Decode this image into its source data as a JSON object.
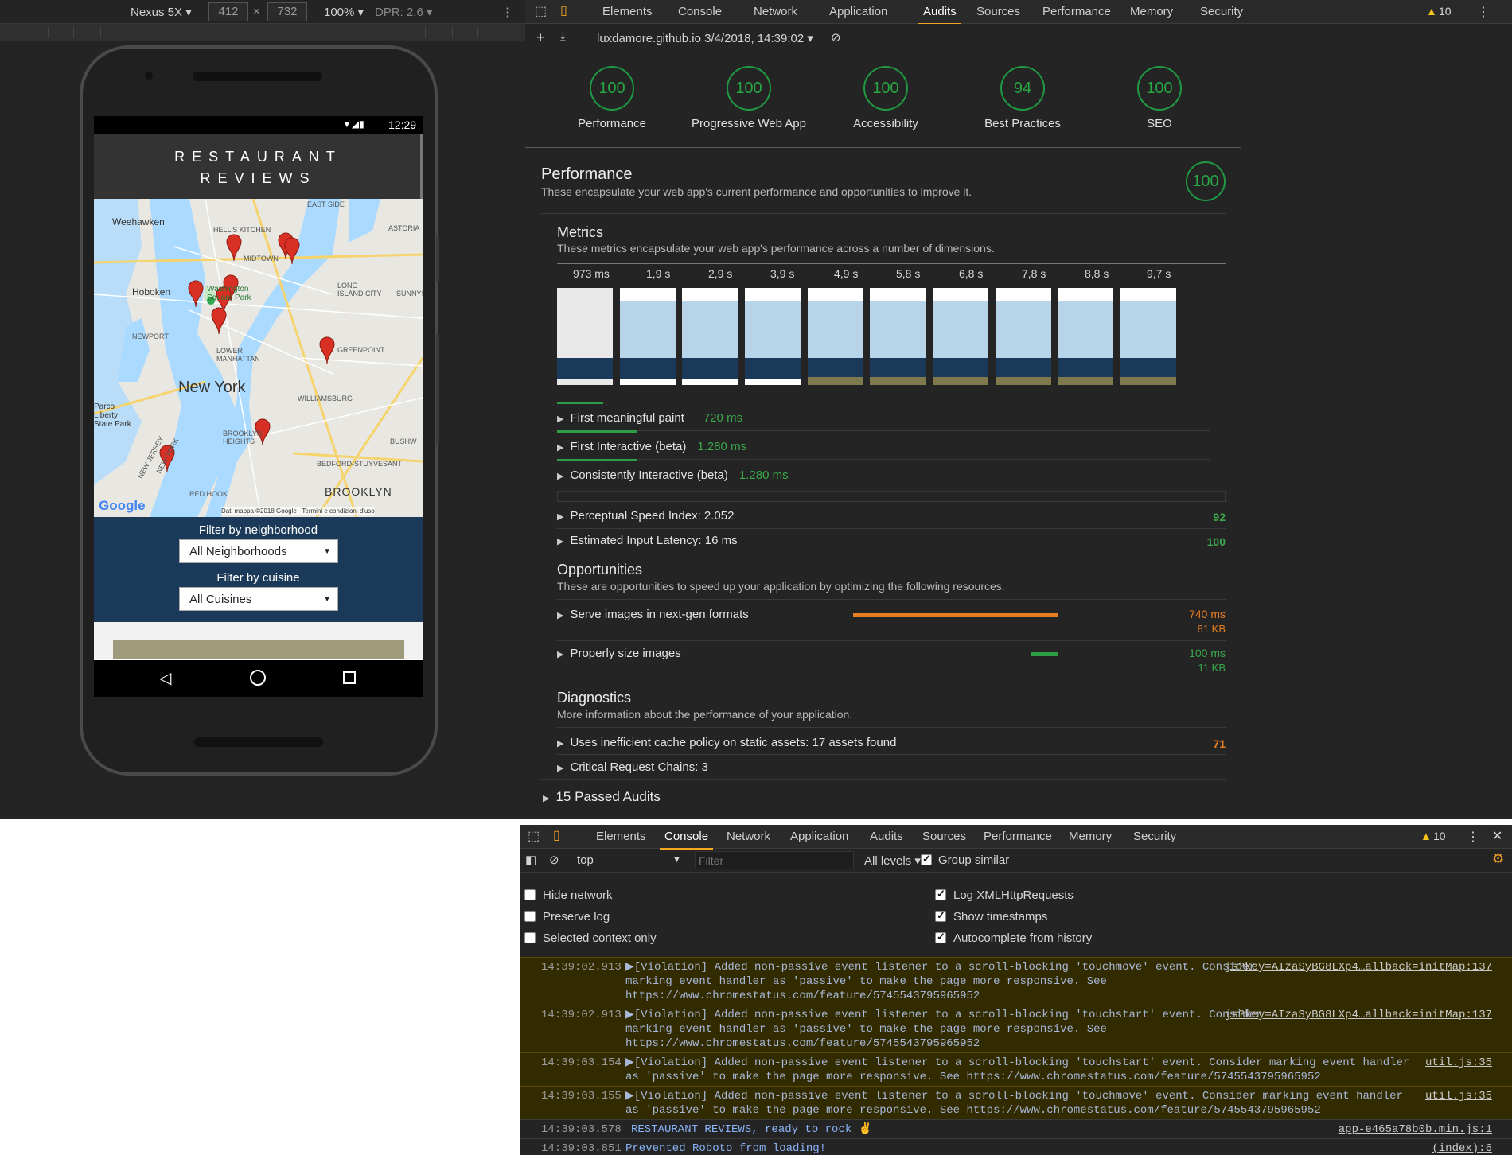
{
  "device_toolbar": {
    "device": "Nexus 5X",
    "width": "412",
    "height": "732",
    "zoom": "100%",
    "dpr": "DPR: 2.6"
  },
  "phone": {
    "status_time": "12:29",
    "app_title_line1": "RESTAURANT",
    "app_title_line2": "REVIEWS",
    "map_city": "New York",
    "map_labels": [
      "Weehawken",
      "HELL'S KITCHEN",
      "MIDTOWN",
      "EAST SIDE",
      "ASTORIA",
      "Hoboken",
      "LONG ISLAND CITY",
      "SUNNYS",
      "NEWPORT",
      "Washington Square Park",
      "LOWER MANHATTAN",
      "GREENPOINT",
      "WILLIAMSBURG",
      "Parco Liberty State Park",
      "BROOKLYN HEIGHTS",
      "BUSHW",
      "NEW JERSEY",
      "NEW YORK",
      "BEDFORD-STUYVESANT",
      "RED HOOK",
      "BROOKLYN"
    ],
    "map_attribution": "Dati mappa ©2018 Google   Termini e condizioni d'uso",
    "google_logo": "Google",
    "filter_neighborhood_label": "Filter by neighborhood",
    "filter_neighborhood_value": "All Neighborhoods",
    "filter_cuisine_label": "Filter by cuisine",
    "filter_cuisine_value": "All Cuisines"
  },
  "top_devtools": {
    "tabs": [
      "Elements",
      "Console",
      "Network",
      "Application",
      "Audits",
      "Sources",
      "Performance",
      "Memory",
      "Security"
    ],
    "active_tab": "Audits",
    "warning_count": "10",
    "report_selector": "luxdamore.github.io 3/4/2018, 14:39:02",
    "categories": [
      {
        "label": "Performance",
        "score": "100"
      },
      {
        "label": "Progressive Web App",
        "score": "100"
      },
      {
        "label": "Accessibility",
        "score": "100"
      },
      {
        "label": "Best Practices",
        "score": "94"
      },
      {
        "label": "SEO",
        "score": "100"
      }
    ],
    "performance": {
      "title": "Performance",
      "description": "These encapsulate your web app's current performance and opportunities to improve it.",
      "score": "100",
      "metrics_title": "Metrics",
      "metrics_description": "These metrics encapsulate your web app's performance across a number of dimensions.",
      "filmstrip_times": [
        "973 ms",
        "1,9 s",
        "2,9 s",
        "3,9 s",
        "4,9 s",
        "5,8 s",
        "6,8 s",
        "7,8 s",
        "8,8 s",
        "9,7 s"
      ],
      "metrics": [
        {
          "label": "First meaningful paint",
          "value": "720 ms"
        },
        {
          "label": "First Interactive (beta)",
          "value": "1.280 ms"
        },
        {
          "label": "Consistently Interactive (beta)",
          "value": "1.280 ms"
        }
      ],
      "scored_metrics": [
        {
          "label": "Perceptual Speed Index: 2.052",
          "score": "92"
        },
        {
          "label": "Estimated Input Latency: 16 ms",
          "score": "100"
        }
      ],
      "opportunities_title": "Opportunities",
      "opportunities_description": "These are opportunities to speed up your application by optimizing the following resources.",
      "opportunities": [
        {
          "label": "Serve images in next-gen formats",
          "time": "740 ms",
          "size": "81 KB",
          "fraction": 1.0
        },
        {
          "label": "Properly size images",
          "time": "100 ms",
          "size": "11 KB",
          "fraction": 0.135
        }
      ],
      "diagnostics_title": "Diagnostics",
      "diagnostics_description": "More information about the performance of your application.",
      "diagnostics": [
        {
          "label": "Uses inefficient cache policy on static assets: 17 assets found",
          "score": "71"
        },
        {
          "label": "Critical Request Chains: 3",
          "score": ""
        }
      ],
      "passed_audits": "15 Passed Audits"
    }
  },
  "bottom_devtools": {
    "tabs": [
      "Elements",
      "Console",
      "Network",
      "Application",
      "Audits",
      "Sources",
      "Performance",
      "Memory",
      "Security"
    ],
    "active_tab": "Console",
    "warning_count": "10",
    "context": "top",
    "filter_placeholder": "Filter",
    "levels": "All levels",
    "group_similar": "Group similar",
    "settings_left": [
      {
        "label": "Hide network",
        "checked": false
      },
      {
        "label": "Preserve log",
        "checked": false
      },
      {
        "label": "Selected context only",
        "checked": false
      }
    ],
    "settings_right": [
      {
        "label": "Log XMLHttpRequests",
        "checked": true
      },
      {
        "label": "Show timestamps",
        "checked": true
      },
      {
        "label": "Autocomplete from history",
        "checked": true
      }
    ],
    "logs": [
      {
        "time": "14:39:02.913",
        "text": "▶[Violation] Added non-passive event listener to a scroll-blocking 'touchmove' event. Consider marking event handler as 'passive' to make the page more responsive. See https://www.chromestatus.com/feature/5745543795965952",
        "source": "js?key=AIzaSyBG8LXp4…allback=initMap:137"
      },
      {
        "time": "14:39:02.913",
        "text": "▶[Violation] Added non-passive event listener to a scroll-blocking 'touchstart' event. Consider marking event handler as 'passive' to make the page more responsive. See https://www.chromestatus.com/feature/5745543795965952",
        "source": "js?key=AIzaSyBG8LXp4…allback=initMap:137"
      },
      {
        "time": "14:39:03.154",
        "text": "▶[Violation] Added non-passive event listener to a scroll-blocking 'touchstart' event. Consider marking event handler as 'passive' to make the page more responsive. See https://www.chromestatus.com/feature/5745543795965952",
        "source": "util.js:35"
      },
      {
        "time": "14:39:03.155",
        "text": "▶[Violation] Added non-passive event listener to a scroll-blocking 'touchmove' event. Consider marking event handler as 'passive' to make the page more responsive. See https://www.chromestatus.com/feature/5745543795965952",
        "source": "util.js:35"
      },
      {
        "time": "14:39:03.578",
        "text": "RESTAURANT REVIEWS, ready to rock ✌",
        "source": "app-e465a78b0b.min.js:1"
      },
      {
        "time": "14:39:03.851",
        "text": "Prevented Roboto from loading!",
        "source": "(index):6"
      }
    ]
  }
}
